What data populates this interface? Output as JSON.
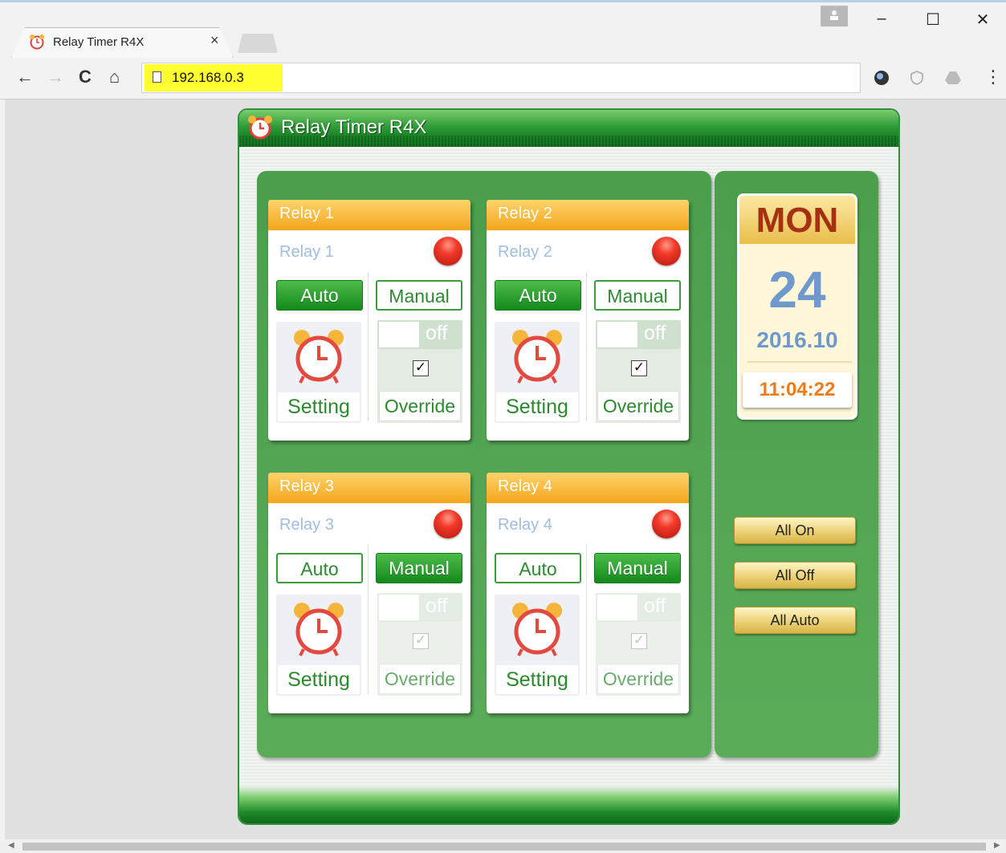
{
  "browser": {
    "tab_title": "Relay Timer R4X",
    "tab_close": "×",
    "url": "192.168.0.3",
    "window_controls": {
      "minimize": "–",
      "maximize": "☐",
      "close": "✕"
    },
    "nav": {
      "back": "←",
      "forward": "→",
      "reload": "C",
      "home": "⌂",
      "menu": "⋮"
    },
    "icons": [
      "back-icon",
      "forward-icon",
      "reload-icon",
      "home-icon",
      "page-icon",
      "extension-icon",
      "shield-icon",
      "drive-icon",
      "menu-icon"
    ]
  },
  "app": {
    "title": "Relay Timer R4X",
    "relays": [
      {
        "header": "Relay 1",
        "name": "Relay 1",
        "auto_label": "Auto",
        "manual_label": "Manual",
        "mode": "auto",
        "toggle_text": "off",
        "override_check": "✓",
        "setting_label": "Setting",
        "override_label": "Override",
        "status_color": "#f23a2a"
      },
      {
        "header": "Relay 2",
        "name": "Relay 2",
        "auto_label": "Auto",
        "manual_label": "Manual",
        "mode": "auto",
        "toggle_text": "off",
        "override_check": "✓",
        "setting_label": "Setting",
        "override_label": "Override",
        "status_color": "#f23a2a"
      },
      {
        "header": "Relay 3",
        "name": "Relay 3",
        "auto_label": "Auto",
        "manual_label": "Manual",
        "mode": "manual",
        "toggle_text": "off",
        "override_check": "✓",
        "setting_label": "Setting",
        "override_label": "Override",
        "status_color": "#f23a2a"
      },
      {
        "header": "Relay 4",
        "name": "Relay 4",
        "auto_label": "Auto",
        "manual_label": "Manual",
        "mode": "manual",
        "toggle_text": "off",
        "override_check": "✓",
        "setting_label": "Setting",
        "override_label": "Override",
        "status_color": "#f23a2a"
      }
    ],
    "date": {
      "day_of_week": "MON",
      "day": "24",
      "year_month": "2016.10",
      "time": "11:04:22"
    },
    "buttons": {
      "all_on": "All On",
      "all_off": "All Off",
      "all_auto": "All Auto"
    },
    "colors": {
      "panel_green": "#4a9e4c",
      "header_orange": "#f3a51c",
      "active_green": "#138a1c",
      "time_orange": "#f07a1a",
      "day_blue": "#6f99cc",
      "dow_red": "#a63012"
    }
  }
}
